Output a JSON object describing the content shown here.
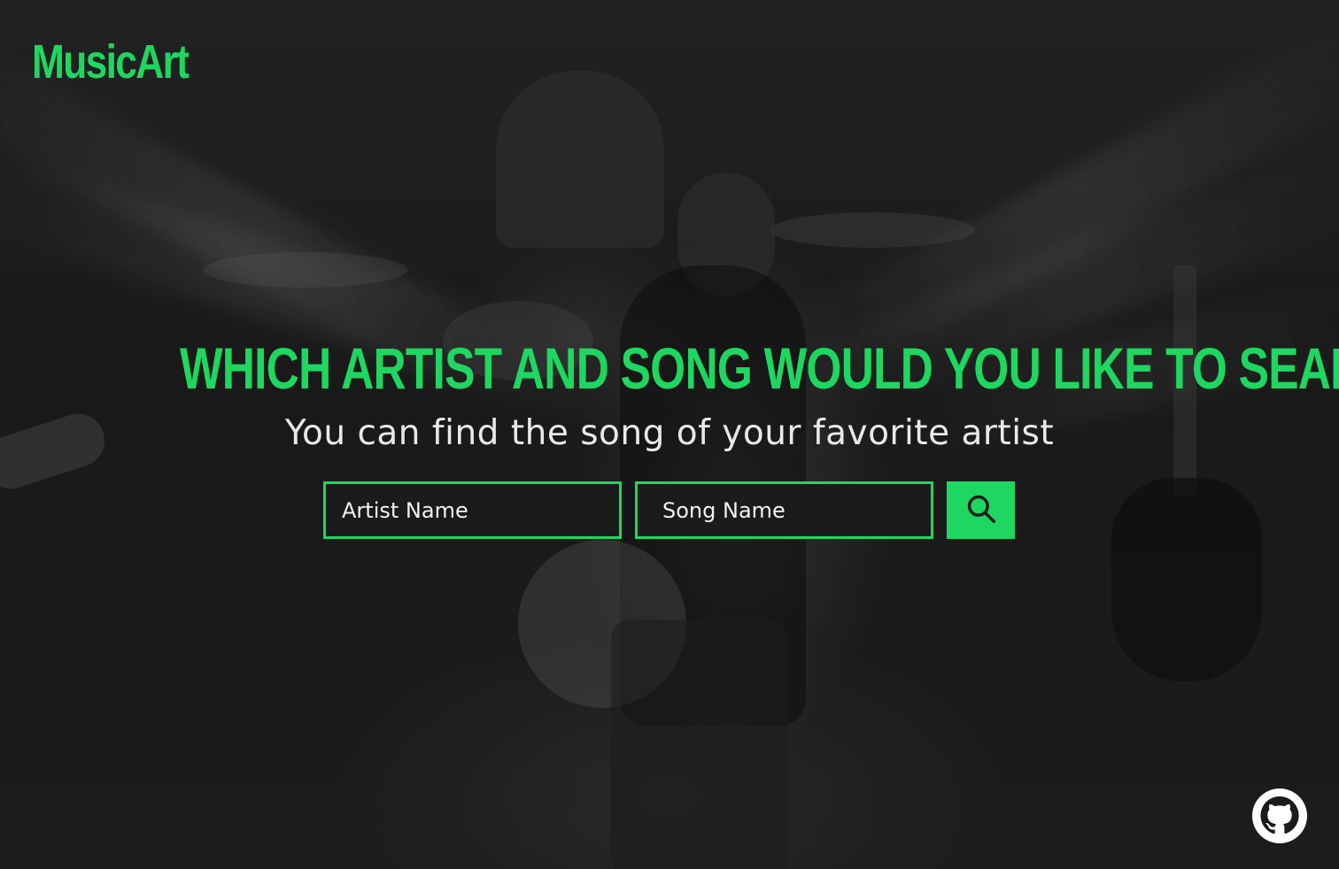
{
  "brand": {
    "logo_text": "MusicArt",
    "accent_color": "#1ed760"
  },
  "hero": {
    "headline": "WHICH ARTIST AND SONG WOULD YOU LIKE TO SEARCH?",
    "subheadline": "You can find the song of your favorite artist"
  },
  "search": {
    "artist_placeholder": "Artist Name",
    "song_placeholder": "Song Name",
    "button_icon": "search-icon"
  },
  "footer": {
    "github_icon": "github-icon"
  }
}
